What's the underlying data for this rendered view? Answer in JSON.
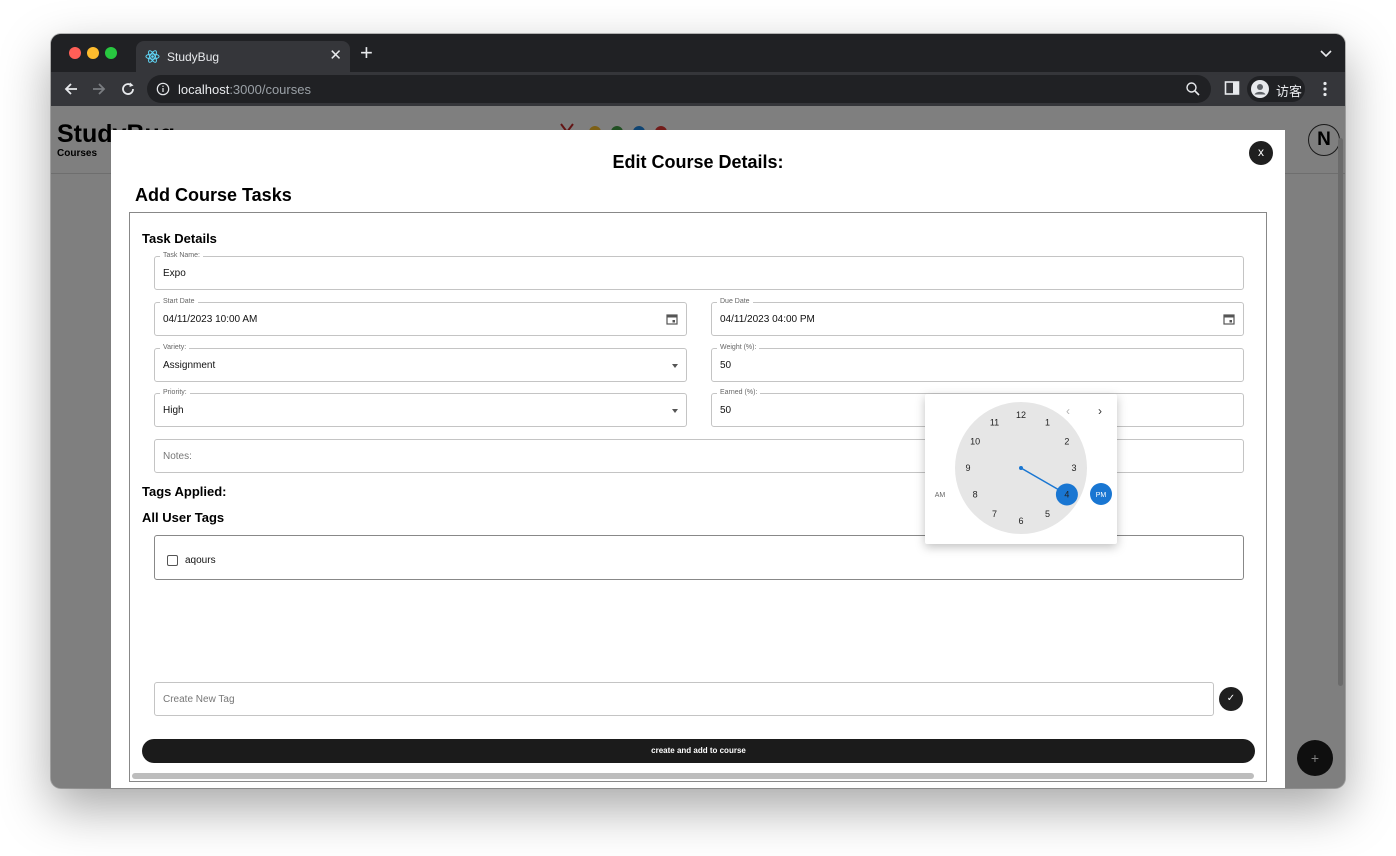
{
  "browser": {
    "tab_title": "StudyBug",
    "url_host": "localhost",
    "url_path": ":3000/courses",
    "profile_name": "访客"
  },
  "app": {
    "logo": "StudyBug",
    "subtitle": "Courses",
    "user_initial": "N",
    "fab_label": "+"
  },
  "modal": {
    "title": "Edit Course Details:",
    "close_label": "x",
    "section_title": "Add Course Tasks",
    "task_details_heading": "Task Details",
    "fields": {
      "task_name": {
        "label": "Task Name:",
        "value": "Expo"
      },
      "start_date": {
        "label": "Start Date",
        "value": "04/11/2023 10:00 AM"
      },
      "due_date": {
        "label": "Due Date",
        "value": "04/11/2023 04:00 PM"
      },
      "variety": {
        "label": "Variety:",
        "value": "Assignment"
      },
      "weight": {
        "label": "Weight (%):",
        "value": "50"
      },
      "priority": {
        "label": "Priority:",
        "value": "High"
      },
      "earned": {
        "label": "Earned (%):",
        "value": "50"
      },
      "notes": {
        "placeholder": "Notes:"
      }
    },
    "tags_applied_heading": "Tags Applied:",
    "all_user_tags_heading": "All User Tags",
    "user_tags": [
      {
        "label": "aqours",
        "checked": false
      }
    ],
    "new_tag_placeholder": "Create New Tag",
    "confirm_label": "✓",
    "submit_label": "create and add to course"
  },
  "clock_picker": {
    "hours": [
      "12",
      "1",
      "2",
      "3",
      "4",
      "5",
      "6",
      "7",
      "8",
      "9",
      "10",
      "11"
    ],
    "selected_hour": "4",
    "am_label": "AM",
    "pm_label": "PM",
    "selected_period": "PM",
    "accent_color": "#1976d2"
  }
}
